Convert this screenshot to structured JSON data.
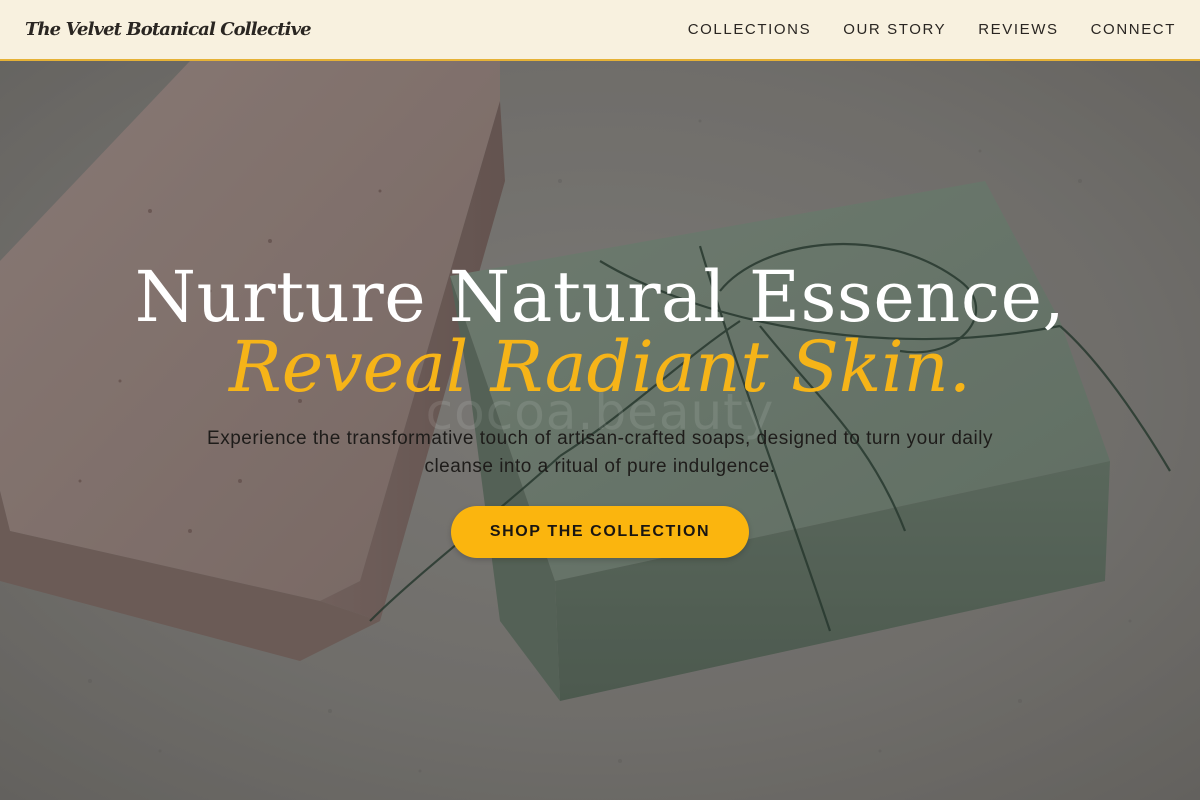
{
  "header": {
    "brand": "The Velvet Botanical Collective",
    "nav": [
      {
        "label": "COLLECTIONS"
      },
      {
        "label": "OUR STORY"
      },
      {
        "label": "REVIEWS"
      },
      {
        "label": "CONNECT"
      }
    ]
  },
  "hero": {
    "headline_line1": "Nurture Natural Essence,",
    "headline_line2": "Reveal Radiant Skin.",
    "watermark": "cocoa.beauty",
    "subtext": "Experience the transformative touch of artisan-crafted soaps, designed to turn your daily cleanse into a ritual of pure indulgence.",
    "cta_label": "SHOP THE COLLECTION"
  },
  "colors": {
    "header_bg": "#f8f1df",
    "accent": "#fbb50e",
    "headline_accent": "#f6b418",
    "text_dark": "#2a2622"
  }
}
